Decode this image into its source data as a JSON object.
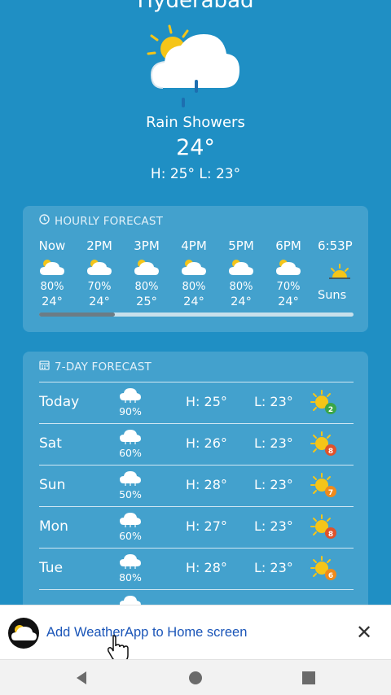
{
  "location": {
    "city": "Hyderabad"
  },
  "current": {
    "condition": "Rain Showers",
    "temperature": "24°",
    "high_low": "H: 25°  L: 23°",
    "icon": "sun-cloud-rain-icon"
  },
  "hourly": {
    "title": "HOURLY FORECAST",
    "icon": "clock-icon",
    "items": [
      {
        "time": "Now",
        "precip": "80%",
        "temp": "24°",
        "icon": "cloud-sun-icon"
      },
      {
        "time": "2PM",
        "precip": "70%",
        "temp": "24°",
        "icon": "cloud-sun-icon"
      },
      {
        "time": "3PM",
        "precip": "80%",
        "temp": "25°",
        "icon": "cloud-sun-icon"
      },
      {
        "time": "4PM",
        "precip": "80%",
        "temp": "24°",
        "icon": "cloud-sun-icon"
      },
      {
        "time": "5PM",
        "precip": "80%",
        "temp": "24°",
        "icon": "cloud-sun-icon"
      },
      {
        "time": "6PM",
        "precip": "70%",
        "temp": "24°",
        "icon": "cloud-sun-icon"
      },
      {
        "time": "6:53P",
        "precip": "",
        "temp": "Suns",
        "icon": "sunset-icon"
      }
    ],
    "scroll_fraction": 0.24
  },
  "daily": {
    "title": "7-DAY FORECAST",
    "icon": "calendar-icon",
    "items": [
      {
        "day": "Today",
        "precip": "90%",
        "high": "H: 25°",
        "low": "L: 23°",
        "uv": "2",
        "uv_color": "#3aa648"
      },
      {
        "day": "Sat",
        "precip": "60%",
        "high": "H: 26°",
        "low": "L: 23°",
        "uv": "8",
        "uv_color": "#e0522a"
      },
      {
        "day": "Sun",
        "precip": "50%",
        "high": "H: 28°",
        "low": "L: 23°",
        "uv": "7",
        "uv_color": "#ef8a1c"
      },
      {
        "day": "Mon",
        "precip": "60%",
        "high": "H: 27°",
        "low": "L: 23°",
        "uv": "8",
        "uv_color": "#e0522a"
      },
      {
        "day": "Tue",
        "precip": "80%",
        "high": "H: 28°",
        "low": "L: 23°",
        "uv": "6",
        "uv_color": "#ef8a1c"
      }
    ]
  },
  "install_banner": {
    "text": "Add WeatherApp to Home screen",
    "close_icon": "close-icon"
  },
  "navigation": {
    "back_icon": "back-triangle-icon",
    "home_icon": "home-circle-icon",
    "recents_icon": "recents-square-icon"
  },
  "colors": {
    "background": "#1f8fc4",
    "banner_link": "#1a55b8"
  }
}
